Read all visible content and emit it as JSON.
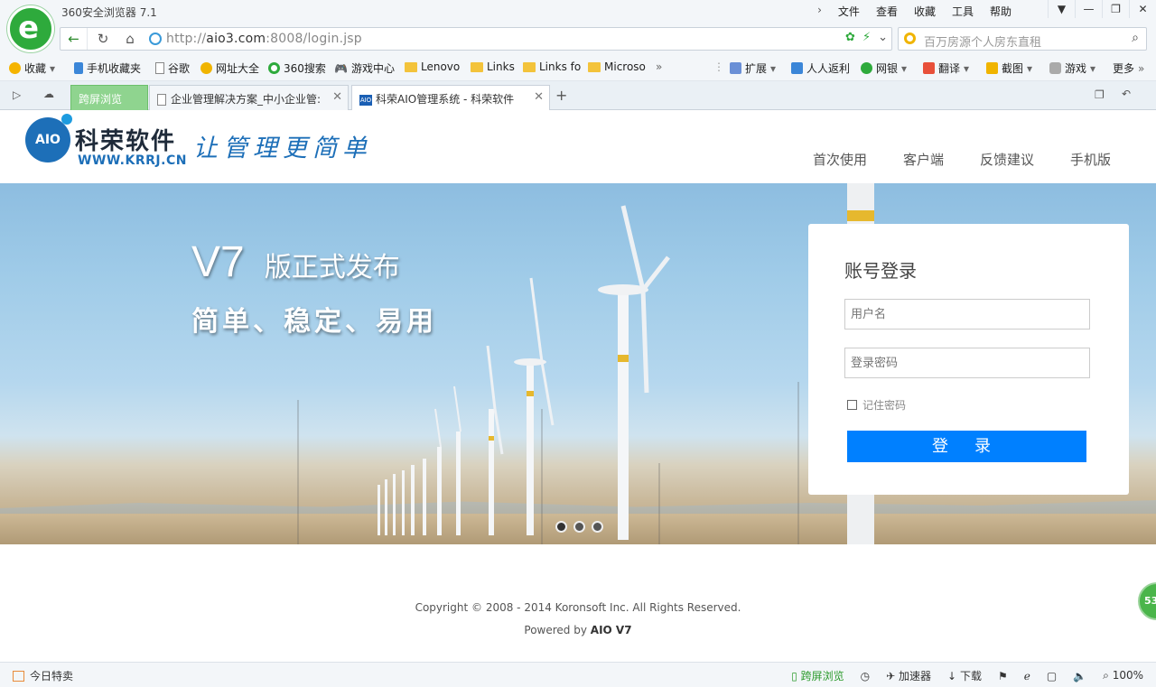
{
  "browser": {
    "app_title": "360安全浏览器 7.1",
    "menu": [
      "文件",
      "查看",
      "收藏",
      "工具",
      "帮助"
    ],
    "url": "http://aio3.com:8008/login.jsp",
    "url_host": "aio3.com",
    "search_placeholder": "百万房源个人房东直租",
    "favorites": [
      "收藏",
      "手机收藏夹",
      "谷歌",
      "网址大全",
      "360搜索",
      "游戏中心",
      "Lenovo",
      "Links",
      "Links fo",
      "Microso"
    ],
    "fav_right": [
      "扩展",
      "人人返利",
      "网银",
      "翻译",
      "截图",
      "游戏",
      "更多"
    ],
    "tabs": [
      {
        "label": "跨屏浏览"
      },
      {
        "label": "企业管理解决方案_中小企业管:"
      },
      {
        "label": "科荣AIO管理系统 - 科荣软件"
      }
    ],
    "status": {
      "left": "今日特卖",
      "cross_screen": "跨屏浏览",
      "accelerator": "加速器",
      "download": "下载",
      "zoom": "100%"
    },
    "float_badge": "53"
  },
  "site": {
    "brand_badge": "AIO",
    "brand_cn": "科荣软件",
    "brand_en": "WWW.KRRJ.CN",
    "slogan": "让管理更简单",
    "nav": [
      "首次使用",
      "客户端",
      "反馈建议",
      "手机版"
    ]
  },
  "hero": {
    "version": "V7",
    "headline": "版正式发布",
    "subline": "简单、稳定、易用",
    "slide_count": 3,
    "active_slide": 1
  },
  "login": {
    "title": "账号登录",
    "username_placeholder": "用户名",
    "password_placeholder": "登录密码",
    "remember_label": "记住密码",
    "submit_label": "登 录"
  },
  "footer": {
    "copyright": "Copyright © 2008 - 2014 Koronsoft Inc. All Rights Reserved.",
    "powered_prefix": "Powered by",
    "powered_product": "AIO V7"
  }
}
